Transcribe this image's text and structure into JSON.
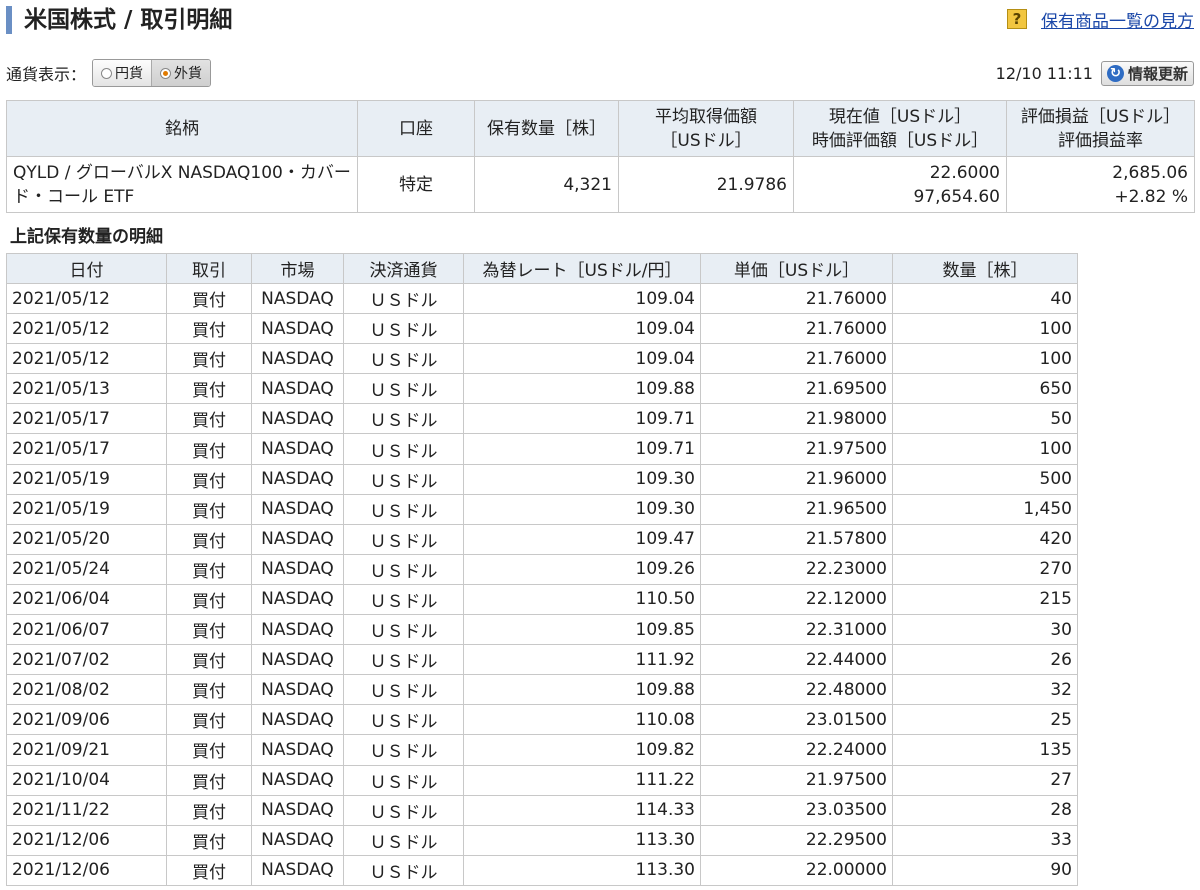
{
  "page": {
    "title": "米国株式 / 取引明細",
    "help_icon": "?",
    "help_link": "保有商品一覧の見方"
  },
  "currency": {
    "label": "通貨表示：",
    "options": [
      "円貨",
      "外貨"
    ],
    "selected": "外貨"
  },
  "update": {
    "timestamp": "12/10 11:11",
    "refresh_label": "情報更新",
    "refresh_icon": "refresh-icon"
  },
  "holding": {
    "headers": {
      "stock": "銘柄",
      "account": "口座",
      "quantity": "保有数量［株］",
      "avg_cost_1": "平均取得価額",
      "avg_cost_2": "［USドル］",
      "current_1": "現在値［USドル］",
      "current_2": "時価評価額［USドル］",
      "pl_1": "評価損益［USドル］",
      "pl_2": "評価損益率"
    },
    "row": {
      "stock": "QYLD / グローバルX NASDAQ100・カバード・コール ETF",
      "account": "特定",
      "quantity": "4,321",
      "avg_cost": "21.9786",
      "current_price": "22.6000",
      "market_value": "97,654.60",
      "pl_amount": "2,685.06",
      "pl_rate": "+2.82 %"
    }
  },
  "detail": {
    "heading": "上記保有数量の明細",
    "headers": [
      "日付",
      "取引",
      "市場",
      "決済通貨",
      "為替レート［USドル/円］",
      "単価［USドル］",
      "数量［株］"
    ],
    "rows": [
      [
        "2021/05/12",
        "買付",
        "NASDAQ",
        "ＵＳドル",
        "109.04",
        "21.76000",
        "40"
      ],
      [
        "2021/05/12",
        "買付",
        "NASDAQ",
        "ＵＳドル",
        "109.04",
        "21.76000",
        "100"
      ],
      [
        "2021/05/12",
        "買付",
        "NASDAQ",
        "ＵＳドル",
        "109.04",
        "21.76000",
        "100"
      ],
      [
        "2021/05/13",
        "買付",
        "NASDAQ",
        "ＵＳドル",
        "109.88",
        "21.69500",
        "650"
      ],
      [
        "2021/05/17",
        "買付",
        "NASDAQ",
        "ＵＳドル",
        "109.71",
        "21.98000",
        "50"
      ],
      [
        "2021/05/17",
        "買付",
        "NASDAQ",
        "ＵＳドル",
        "109.71",
        "21.97500",
        "100"
      ],
      [
        "2021/05/19",
        "買付",
        "NASDAQ",
        "ＵＳドル",
        "109.30",
        "21.96000",
        "500"
      ],
      [
        "2021/05/19",
        "買付",
        "NASDAQ",
        "ＵＳドル",
        "109.30",
        "21.96500",
        "1,450"
      ],
      [
        "2021/05/20",
        "買付",
        "NASDAQ",
        "ＵＳドル",
        "109.47",
        "21.57800",
        "420"
      ],
      [
        "2021/05/24",
        "買付",
        "NASDAQ",
        "ＵＳドル",
        "109.26",
        "22.23000",
        "270"
      ],
      [
        "2021/06/04",
        "買付",
        "NASDAQ",
        "ＵＳドル",
        "110.50",
        "22.12000",
        "215"
      ],
      [
        "2021/06/07",
        "買付",
        "NASDAQ",
        "ＵＳドル",
        "109.85",
        "22.31000",
        "30"
      ],
      [
        "2021/07/02",
        "買付",
        "NASDAQ",
        "ＵＳドル",
        "111.92",
        "22.44000",
        "26"
      ],
      [
        "2021/08/02",
        "買付",
        "NASDAQ",
        "ＵＳドル",
        "109.88",
        "22.48000",
        "32"
      ],
      [
        "2021/09/06",
        "買付",
        "NASDAQ",
        "ＵＳドル",
        "110.08",
        "23.01500",
        "25"
      ],
      [
        "2021/09/21",
        "買付",
        "NASDAQ",
        "ＵＳドル",
        "109.82",
        "22.24000",
        "135"
      ],
      [
        "2021/10/04",
        "買付",
        "NASDAQ",
        "ＵＳドル",
        "111.22",
        "21.97500",
        "27"
      ],
      [
        "2021/11/22",
        "買付",
        "NASDAQ",
        "ＵＳドル",
        "114.33",
        "23.03500",
        "28"
      ],
      [
        "2021/12/06",
        "買付",
        "NASDAQ",
        "ＵＳドル",
        "113.30",
        "22.29500",
        "33"
      ],
      [
        "2021/12/06",
        "買付",
        "NASDAQ",
        "ＵＳドル",
        "113.30",
        "22.00000",
        "90"
      ]
    ]
  },
  "colors": {
    "header_bg": "#e8eef4",
    "title_accent": "#6a8fc4",
    "link": "#1a47a8",
    "help_icon_bg": "#f2c640"
  }
}
